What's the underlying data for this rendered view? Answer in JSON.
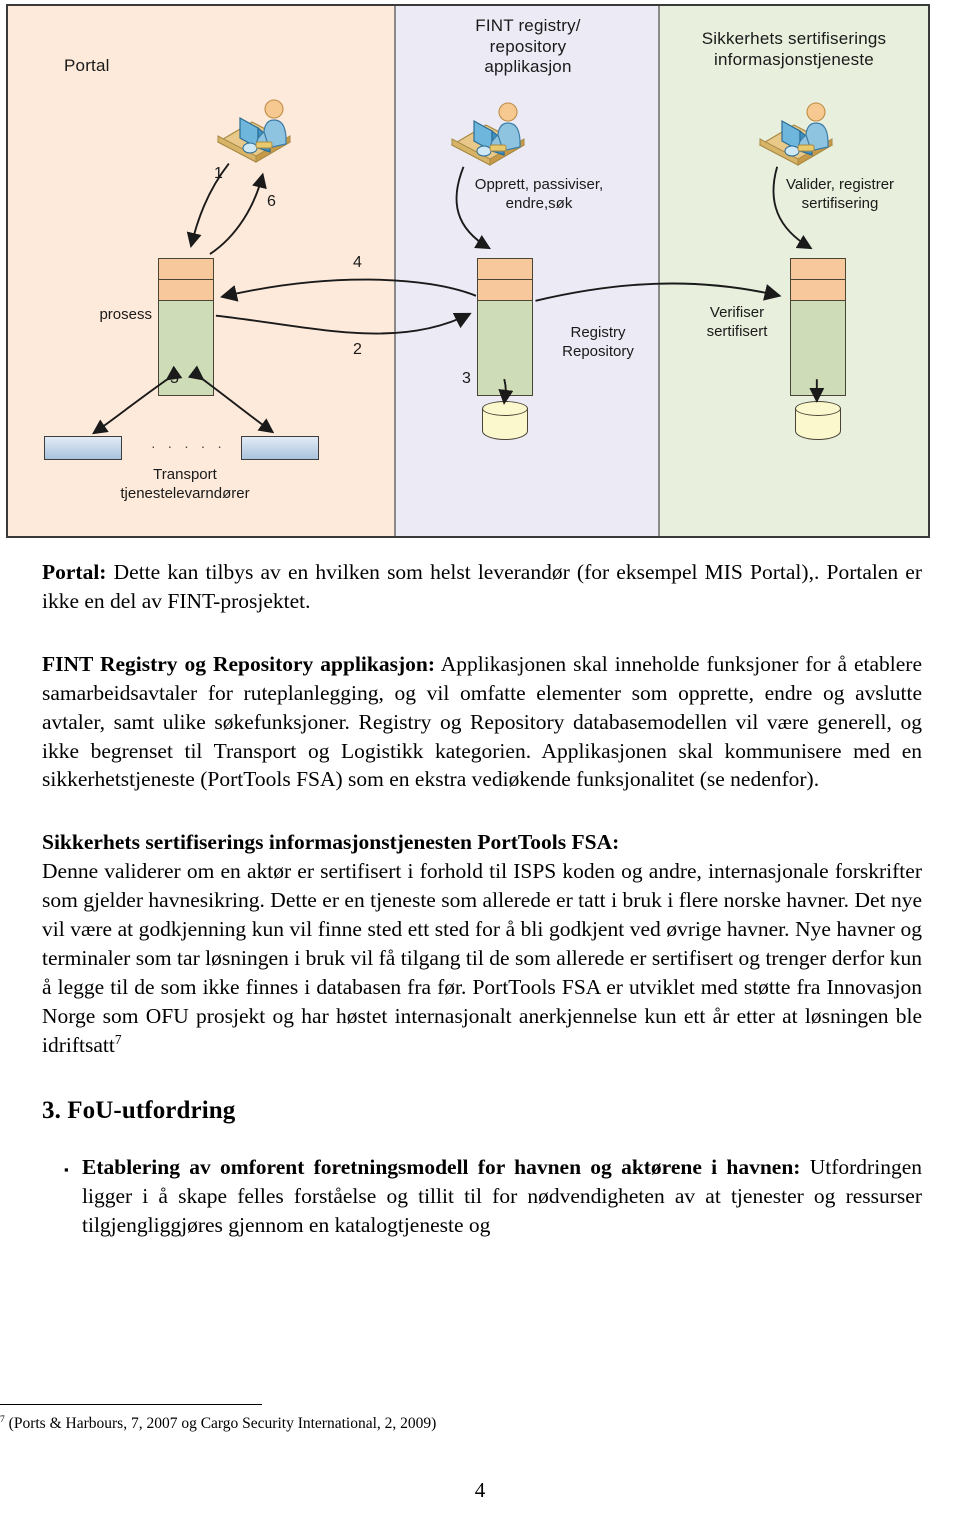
{
  "diagram": {
    "panes": [
      {
        "id": "portal",
        "title": "Portal"
      },
      {
        "id": "fint",
        "title": "FINT registry/\nrepository\napplikasjon"
      },
      {
        "id": "security",
        "title": "Sikkerhets sertifiserings\ninformasjonstjeneste"
      }
    ],
    "labels": {
      "prosess": "prosess",
      "transport": "Transport\ntjenestelevarndører",
      "opprett": "Opprett, passiviser,\nendre,søk",
      "registry_repository": "Registry\nRepository",
      "valider": "Valider, registrer\nsertifisering",
      "verifiser": "Verifiser\nsertifisert",
      "dots": "· · · · ·"
    },
    "flow_numbers": {
      "n1": "1",
      "n2": "2",
      "n3": "3",
      "n4": "4",
      "n5": "5",
      "n6": "6"
    },
    "colors": {
      "pane_portal_bg": "#fdeadb",
      "pane_fint_bg": "#eceaf4",
      "pane_security_bg": "#e8efdd",
      "stack_top_segment": "#f7c89c",
      "stack_body": "#cfdcb8",
      "cylinder": "#fbf8cd",
      "transport_box": "#a9c2dc",
      "border": "#3a3a3a"
    }
  },
  "body": {
    "para_portal": {
      "lead": "Portal:",
      "text": " Dette kan tilbys av en hvilken som helst leverandør (for eksempel MIS Portal),. Portalen er ikke en del av FINT-prosjektet."
    },
    "para_fint": {
      "lead": "FINT Registry og Repository applikasjon:",
      "text": " Applikasjonen skal inneholde funksjoner for å etablere samarbeidsavtaler for ruteplanlegging, og vil omfatte elementer som opprette, endre og avslutte avtaler, samt ulike søkefunksjoner. Registry og Repository databasemodellen vil være generell, og ikke begrenset til Transport og Logistikk kategorien. Applikasjonen skal kommunisere med en sikkerhetstjeneste (PortTools FSA) som en ekstra vediøkende funksjonalitet (se nedenfor)."
    },
    "para_security": {
      "lead": "Sikkerhets sertifiserings informasjonstjenesten PortTools FSA:",
      "text": "Denne validerer om en aktør er sertifisert i forhold til ISPS koden og andre, internasjonale forskrifter som gjelder havnesikring. Dette er en tjeneste som allerede er tatt i bruk i flere norske havner. Det nye vil være at godkjenning kun vil finne sted ett sted for å bli godkjent ved øvrige havner. Nye havner og terminaler som tar løsningen i bruk vil få tilgang til de som allerede er sertifisert og trenger derfor kun å legge til de som ikke finnes i databasen fra før. PortTools  FSA er utviklet med støtte fra Innovasjon Norge som OFU prosjekt og har høstet internasjonalt anerkjennelse kun ett år etter at løsningen ble idriftsatt",
      "footnote_marker": "7"
    },
    "section_heading": "3. FoU-utfordring",
    "bullet": {
      "marker": "▪",
      "lead": "Etablering av omforent foretningsmodell for havnen og aktørene i havnen:",
      "text": " Utfordringen ligger i å skape felles forståelse og tillit til for nødvendigheten av at tjenester og ressurser tilgjengliggjøres gjennom en katalogtjeneste og"
    }
  },
  "footer": {
    "footnote_marker": "7",
    "footnote_text": "(Ports & Harbours, 7, 2007 og Cargo Security International, 2, 2009)",
    "page_number": "4"
  }
}
